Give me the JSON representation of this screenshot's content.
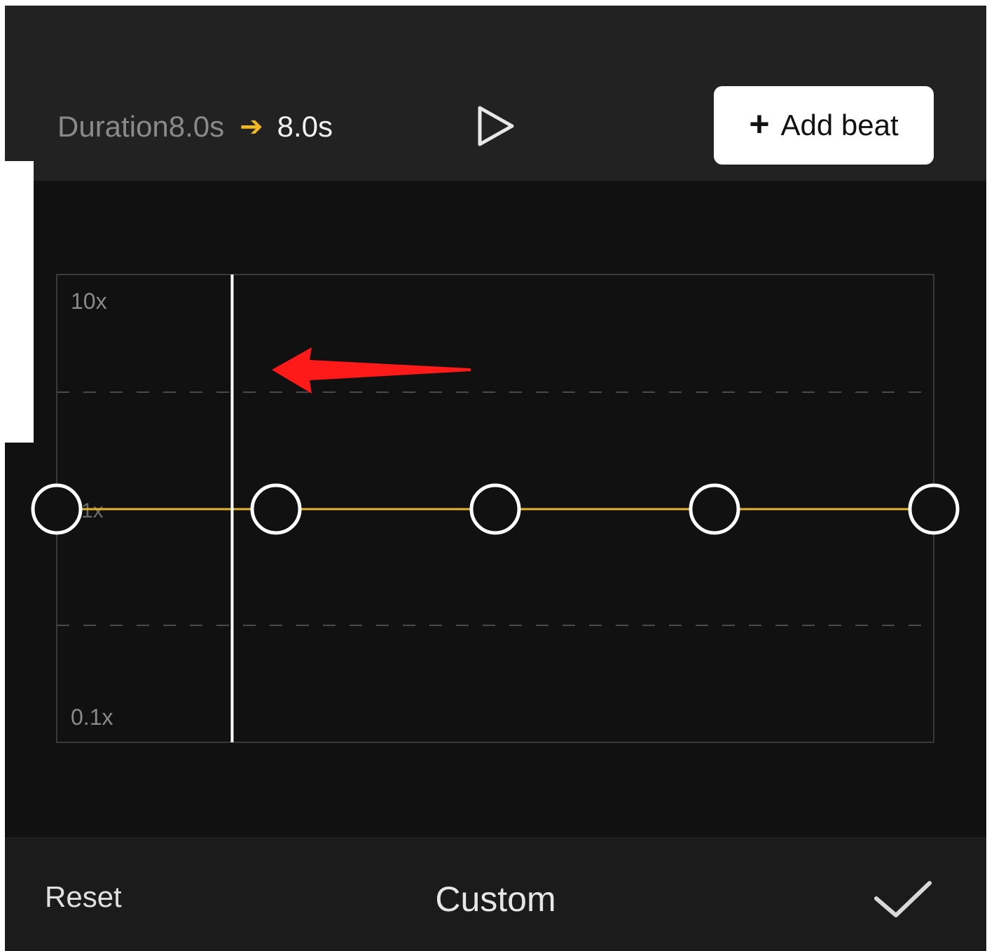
{
  "header": {
    "duration_label": "Duration8.0s",
    "arrow_glyph": "➔",
    "new_duration": "8.0s",
    "add_beat_plus": "+",
    "add_beat_label": "Add beat",
    "play_icon": "play-icon"
  },
  "curve": {
    "top_label": "10x",
    "bottom_label": "0.1x",
    "point_count": 5,
    "point_speed": "1x",
    "playhead_fraction": 0.2,
    "annotation": "red-arrow-left",
    "line_color": "#e6b32e",
    "annotation_color": "#ff1a1a"
  },
  "footer": {
    "reset_label": "Reset",
    "title": "Custom",
    "confirm_icon": "checkmark-icon"
  }
}
